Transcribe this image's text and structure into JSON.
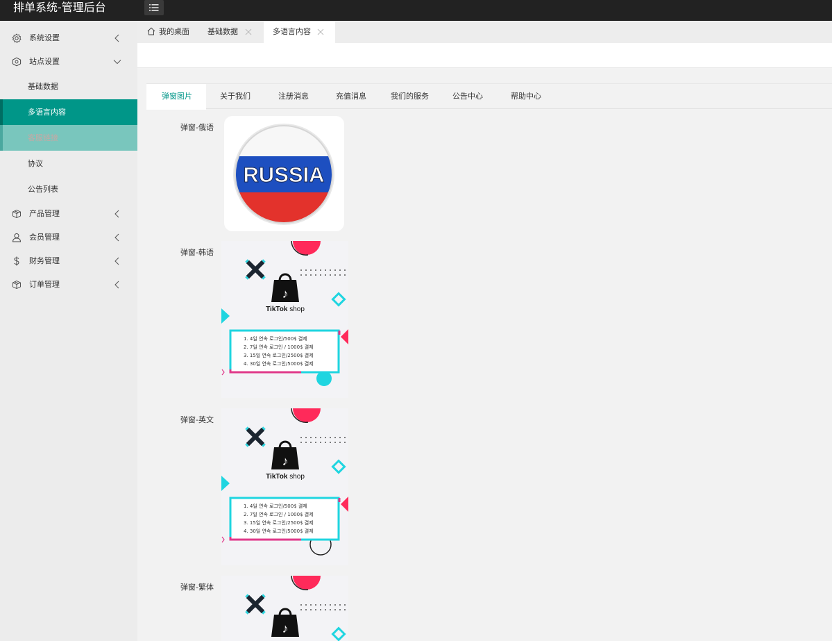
{
  "app": {
    "title": "排单系统-管理后台"
  },
  "sidebar": {
    "items": [
      {
        "label": "系统设置",
        "icon": "gear-icon"
      },
      {
        "label": "站点设置",
        "icon": "site-icon"
      },
      {
        "label": "产品管理",
        "icon": "box-icon"
      },
      {
        "label": "会员管理",
        "icon": "user-icon"
      },
      {
        "label": "财务管理",
        "icon": "dollar-icon"
      },
      {
        "label": "订单管理",
        "icon": "box-icon"
      }
    ],
    "sub_items": [
      {
        "label": "基础数据"
      },
      {
        "label": "多语言内容"
      },
      {
        "label": "客服链接"
      },
      {
        "label": "协议"
      },
      {
        "label": "公告列表"
      }
    ]
  },
  "tabs": [
    {
      "label": "我的桌面",
      "icon": "home-icon"
    },
    {
      "label": "基础数据"
    },
    {
      "label": "多语言内容"
    }
  ],
  "content_tabs": [
    "弹窗图片",
    "关于我们",
    "注册消息",
    "充值消息",
    "我们的服务",
    "公告中心",
    "帮助中心"
  ],
  "rows": [
    {
      "label": "弹窗-俄语"
    },
    {
      "label": "弹窗-韩语"
    },
    {
      "label": "弹窗-英文"
    },
    {
      "label": "弹窗-繁体"
    }
  ],
  "images": {
    "russia_text": "RUSSIA",
    "shop_brand": "TikTok",
    "shop_word": "shop",
    "promo_lines": [
      "1. 4일 연속 로그인/500$ 결제",
      "2. 7일 연속 로그인 / 1000$ 결제",
      "3. 15일 연속 로그인/2500$ 결제",
      "4. 30일 연속 로그인/5000$ 결제"
    ]
  },
  "colors": {
    "accent": "#009688",
    "header": "#222222",
    "accent_light": "#79c6bd"
  }
}
